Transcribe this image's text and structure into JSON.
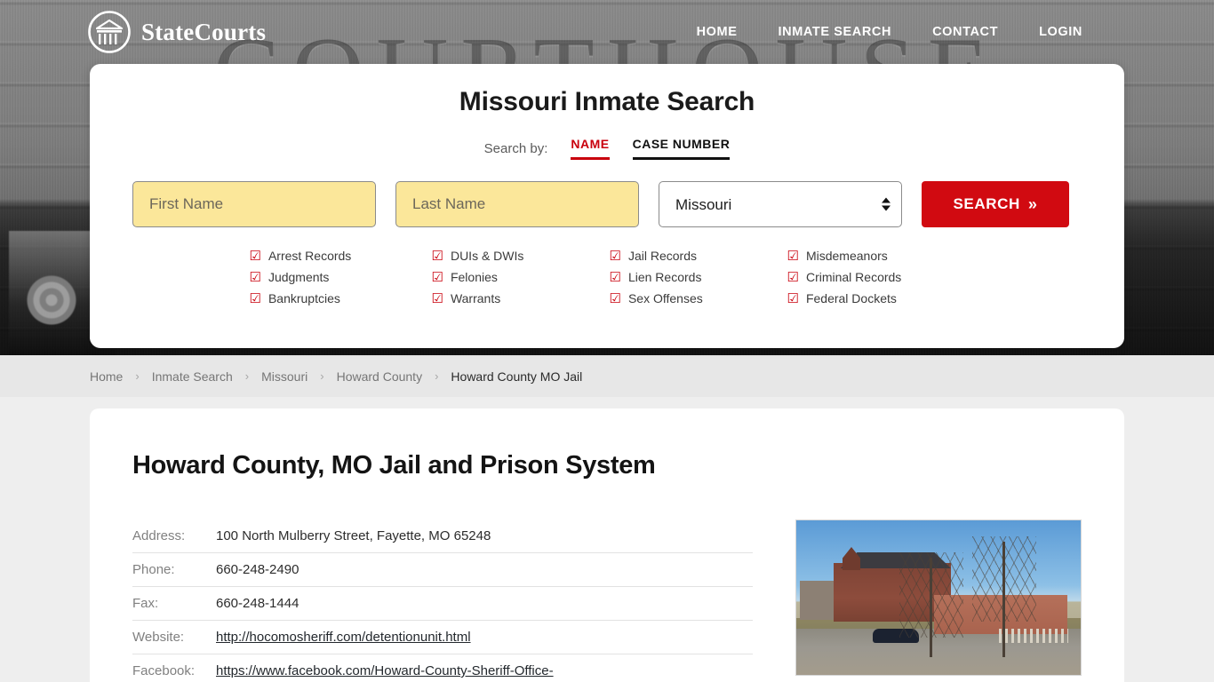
{
  "brand": {
    "name": "StateCourts",
    "logo_icon": "courthouse-circle-icon"
  },
  "nav": [
    {
      "label": "HOME"
    },
    {
      "label": "INMATE SEARCH"
    },
    {
      "label": "CONTACT"
    },
    {
      "label": "LOGIN"
    }
  ],
  "hero": {
    "watermark": "COURTHOUSE"
  },
  "search": {
    "title": "Missouri Inmate Search",
    "search_by_label": "Search by:",
    "tabs": [
      {
        "label": "NAME",
        "active": true,
        "color": "#c9000c"
      },
      {
        "label": "CASE NUMBER",
        "active": false,
        "color": "#111111"
      }
    ],
    "first_name_placeholder": "First Name",
    "first_name_value": "",
    "last_name_placeholder": "Last Name",
    "last_name_value": "",
    "state_selected": "Missouri",
    "state_options": [
      "Missouri"
    ],
    "button_label": "SEARCH",
    "button_chevron": "»",
    "button_color": "#d10a11",
    "field_color": "#fbe79a",
    "record_types": [
      "Arrest Records",
      "DUIs & DWIs",
      "Jail Records",
      "Misdemeanors",
      "Judgments",
      "Felonies",
      "Lien Records",
      "Criminal Records",
      "Bankruptcies",
      "Warrants",
      "Sex Offenses",
      "Federal Dockets"
    ],
    "checkbox_glyph": "☑"
  },
  "breadcrumb": {
    "separator": "›",
    "items": [
      {
        "label": "Home",
        "current": false
      },
      {
        "label": "Inmate Search",
        "current": false
      },
      {
        "label": "Missouri",
        "current": false
      },
      {
        "label": "Howard County",
        "current": false
      },
      {
        "label": "Howard County MO Jail",
        "current": true
      }
    ]
  },
  "page": {
    "title": "Howard County, MO Jail and Prison System",
    "details": [
      {
        "key": "Address:",
        "value": "100 North Mulberry Street, Fayette, MO 65248",
        "link": false
      },
      {
        "key": "Phone:",
        "value": "660-248-2490",
        "link": false
      },
      {
        "key": "Fax:",
        "value": "660-248-1444",
        "link": false
      },
      {
        "key": "Website:",
        "value": "http://hocomosheriff.com/detentionunit.html",
        "link": true
      },
      {
        "key": "Facebook:",
        "value": "https://www.facebook.com/Howard-County-Sheriff-Office-",
        "link": true
      }
    ],
    "photo_caption": "howard-county-mo-jail-photo"
  }
}
